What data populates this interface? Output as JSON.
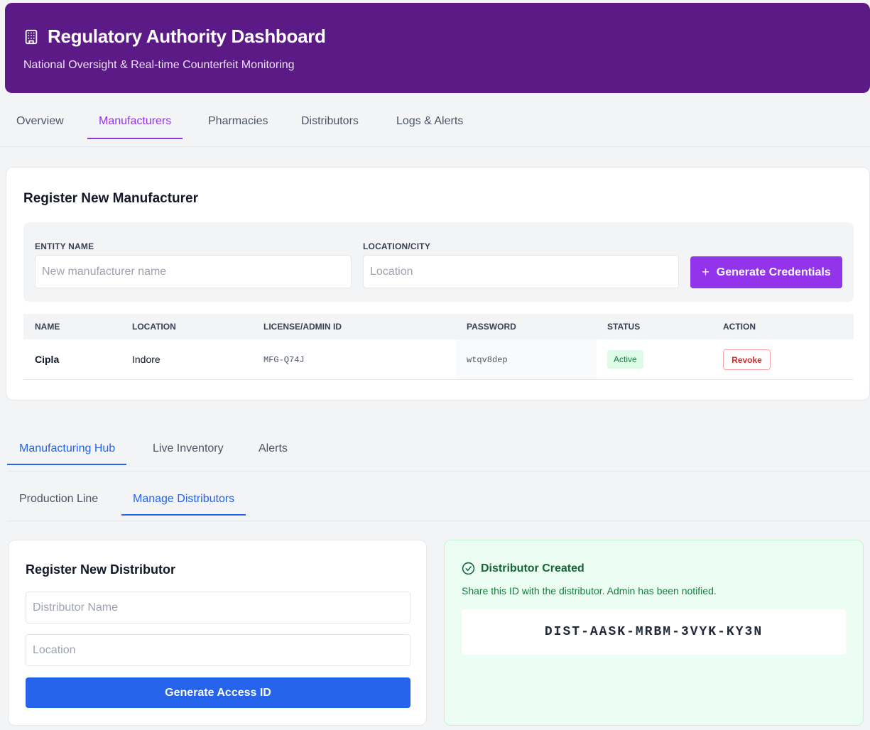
{
  "header": {
    "title": "Regulatory Authority Dashboard",
    "subtitle": "National Oversight & Real-time Counterfeit Monitoring",
    "icon": "building-icon"
  },
  "top_tabs": [
    {
      "label": "Overview",
      "active": false
    },
    {
      "label": "Manufacturers",
      "active": true
    },
    {
      "label": "Pharmacies",
      "active": false
    },
    {
      "label": "Distributors",
      "active": false
    },
    {
      "label": "Logs & Alerts",
      "active": false
    }
  ],
  "register_manufacturer": {
    "title": "Register New Manufacturer",
    "entity_label": "ENTITY NAME",
    "entity_placeholder": "New manufacturer name",
    "location_label": "LOCATION/CITY",
    "location_placeholder": "Location",
    "generate_button": "Generate Credentials",
    "generate_icon": "plus-icon"
  },
  "manufacturers_table": {
    "columns": [
      "NAME",
      "LOCATION",
      "LICENSE/ADMIN ID",
      "PASSWORD",
      "STATUS",
      "ACTION"
    ],
    "rows": [
      {
        "name": "Cipla",
        "location": "Indore",
        "license_id": "MFG-Q74J",
        "password": "wtqv8dep",
        "status": "Active",
        "action": "Revoke"
      }
    ]
  },
  "hub_tabs": [
    {
      "label": "Manufacturing Hub",
      "active": true
    },
    {
      "label": "Live Inventory",
      "active": false
    },
    {
      "label": "Alerts",
      "active": false
    }
  ],
  "sub_tabs": [
    {
      "label": "Production Line",
      "active": false
    },
    {
      "label": "Manage Distributors",
      "active": true
    }
  ],
  "register_distributor": {
    "title": "Register New Distributor",
    "name_placeholder": "Distributor Name",
    "location_placeholder": "Location",
    "button": "Generate Access ID"
  },
  "distributor_created": {
    "icon": "check-circle-icon",
    "title": "Distributor Created",
    "description": "Share this ID with the distributor. Admin has been notified.",
    "access_id": "DIST-AASK-MRBM-3VYK-KY3N"
  },
  "colors": {
    "header_bg": "#5b1a86",
    "accent_purple": "#9333ea",
    "accent_blue": "#2563eb",
    "success_green": "#15803d",
    "danger_red": "#dc2626"
  }
}
